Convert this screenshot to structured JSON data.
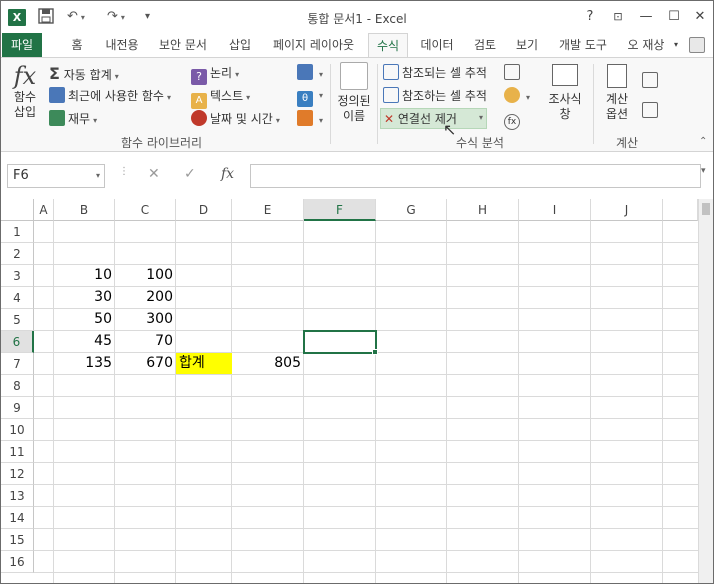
{
  "window": {
    "title": "통합 문서1 - Excel",
    "help": "?",
    "minimize": "—",
    "restore": "▫",
    "close": "✕"
  },
  "tabs": [
    "파일",
    "홈",
    "내전용",
    "보안 문서",
    "삽입",
    "페이지 레이아웃",
    "수식",
    "데이터",
    "검토",
    "보기",
    "개발 도구"
  ],
  "user": "오 재상",
  "ribbon": {
    "insert_function": "함수\n삽입",
    "autosum": "자동 합계",
    "recent": "최근에 사용한 함수",
    "financial": "재무",
    "logical": "논리",
    "text": "텍스트",
    "datetime": "날짜 및 시간",
    "function_library_label": "함수 라이브러리",
    "defined_names": "정의된\n이름",
    "trace_precedents": "참조되는 셀 추적",
    "trace_dependents": "참조하는 셀 추적",
    "remove_arrows": "연결선 제거",
    "watch_window": "조사식\n창",
    "calc_options": "계산\n옵션",
    "formula_auditing_label": "수식 분석",
    "calculation_label": "계산"
  },
  "formula_bar": {
    "name_box": "F6",
    "value": ""
  },
  "grid": {
    "columns": [
      "A",
      "B",
      "C",
      "D",
      "E",
      "F",
      "G",
      "H",
      "I",
      "J"
    ],
    "rows": [
      "1",
      "2",
      "3",
      "4",
      "5",
      "6",
      "7",
      "8",
      "9",
      "10",
      "11",
      "12",
      "13",
      "14",
      "15",
      "16"
    ],
    "selected_cell": "F6",
    "cells": {
      "B3": "10",
      "C3": "100",
      "B4": "30",
      "C4": "200",
      "B5": "50",
      "C5": "300",
      "B6": "45",
      "C6": "70",
      "B7": "135",
      "C7": "670",
      "D7": "합계",
      "E7": "805"
    }
  },
  "colors": {
    "accent": "#217346",
    "highlight": "#ffff00"
  }
}
